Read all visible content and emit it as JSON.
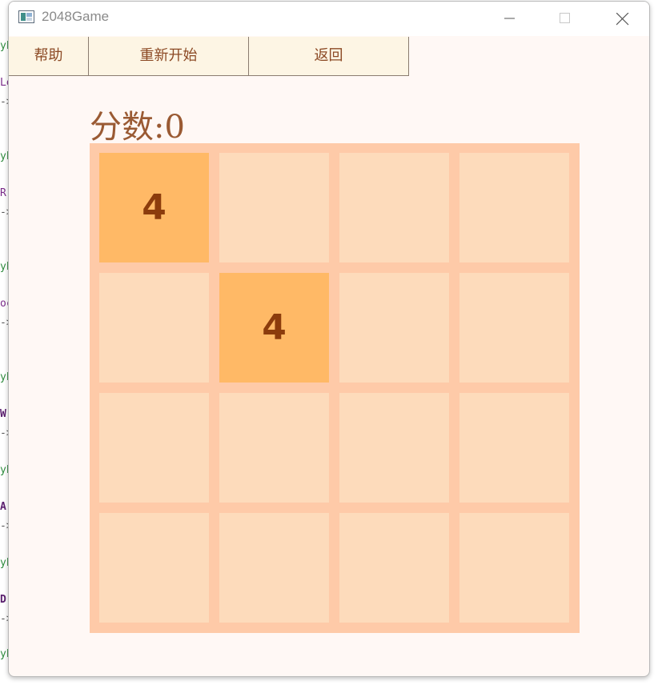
{
  "window": {
    "title": "2048Game"
  },
  "toolbar": {
    "help": "帮助",
    "restart": "重新开始",
    "back": "返回"
  },
  "score": {
    "label": "分数:",
    "value": "0"
  },
  "board": {
    "rows": 4,
    "cols": 4,
    "cells": [
      [
        "4",
        "",
        "",
        ""
      ],
      [
        "",
        "4",
        "",
        ""
      ],
      [
        "",
        "",
        "",
        ""
      ],
      [
        "",
        "",
        "",
        ""
      ]
    ]
  },
  "background_code": [
    "yE",
    "Le",
    "->",
    "yE",
    "R",
    "->",
    "yE",
    "oc",
    "->",
    "yE",
    "W:",
    "->",
    "yE",
    "A:",
    "->",
    "yE",
    "D:",
    "->",
    "yE"
  ],
  "colors": {
    "board_bg": "#fecaa8",
    "empty_tile": "#fddbbb",
    "tile_4": "#ffb966",
    "tile_text": "#8c3c0c",
    "score_text": "#9a5a33",
    "button_bg": "#fdf5e4"
  }
}
